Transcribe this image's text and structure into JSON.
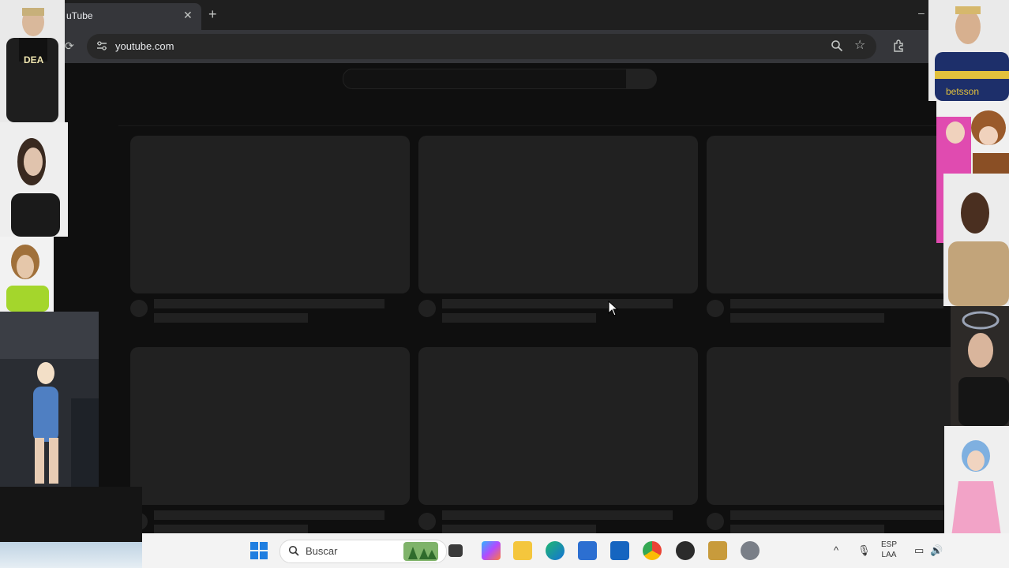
{
  "browser": {
    "tab_title": "uTube",
    "url": "youtube.com",
    "new_tab_symbol": "+",
    "close_symbol": "✕"
  },
  "taskbar": {
    "search_placeholder": "Buscar",
    "lang_line1": "ESP",
    "lang_line2": "LAA",
    "icons": [
      "windows-start-icon",
      "search-icon",
      "scenery-widget-icon",
      "task-view-icon",
      "copilot-icon",
      "file-explorer-icon",
      "edge-icon",
      "store-icon",
      "outlook-icon",
      "chrome-icon",
      "obs-icon",
      "league-icon",
      "settings-icon",
      "tray-chevron-icon",
      "microphone-icon",
      "network-icon",
      "volume-icon"
    ]
  },
  "overlays": {
    "top_left_badge": "DEA",
    "top_right_sponsor": "betsson"
  },
  "colors": {
    "page_bg": "#0f0f0f",
    "skeleton": "#212121",
    "chrome_dark": "#1f1f1f",
    "taskbar_bg": "#f3f3f3"
  }
}
